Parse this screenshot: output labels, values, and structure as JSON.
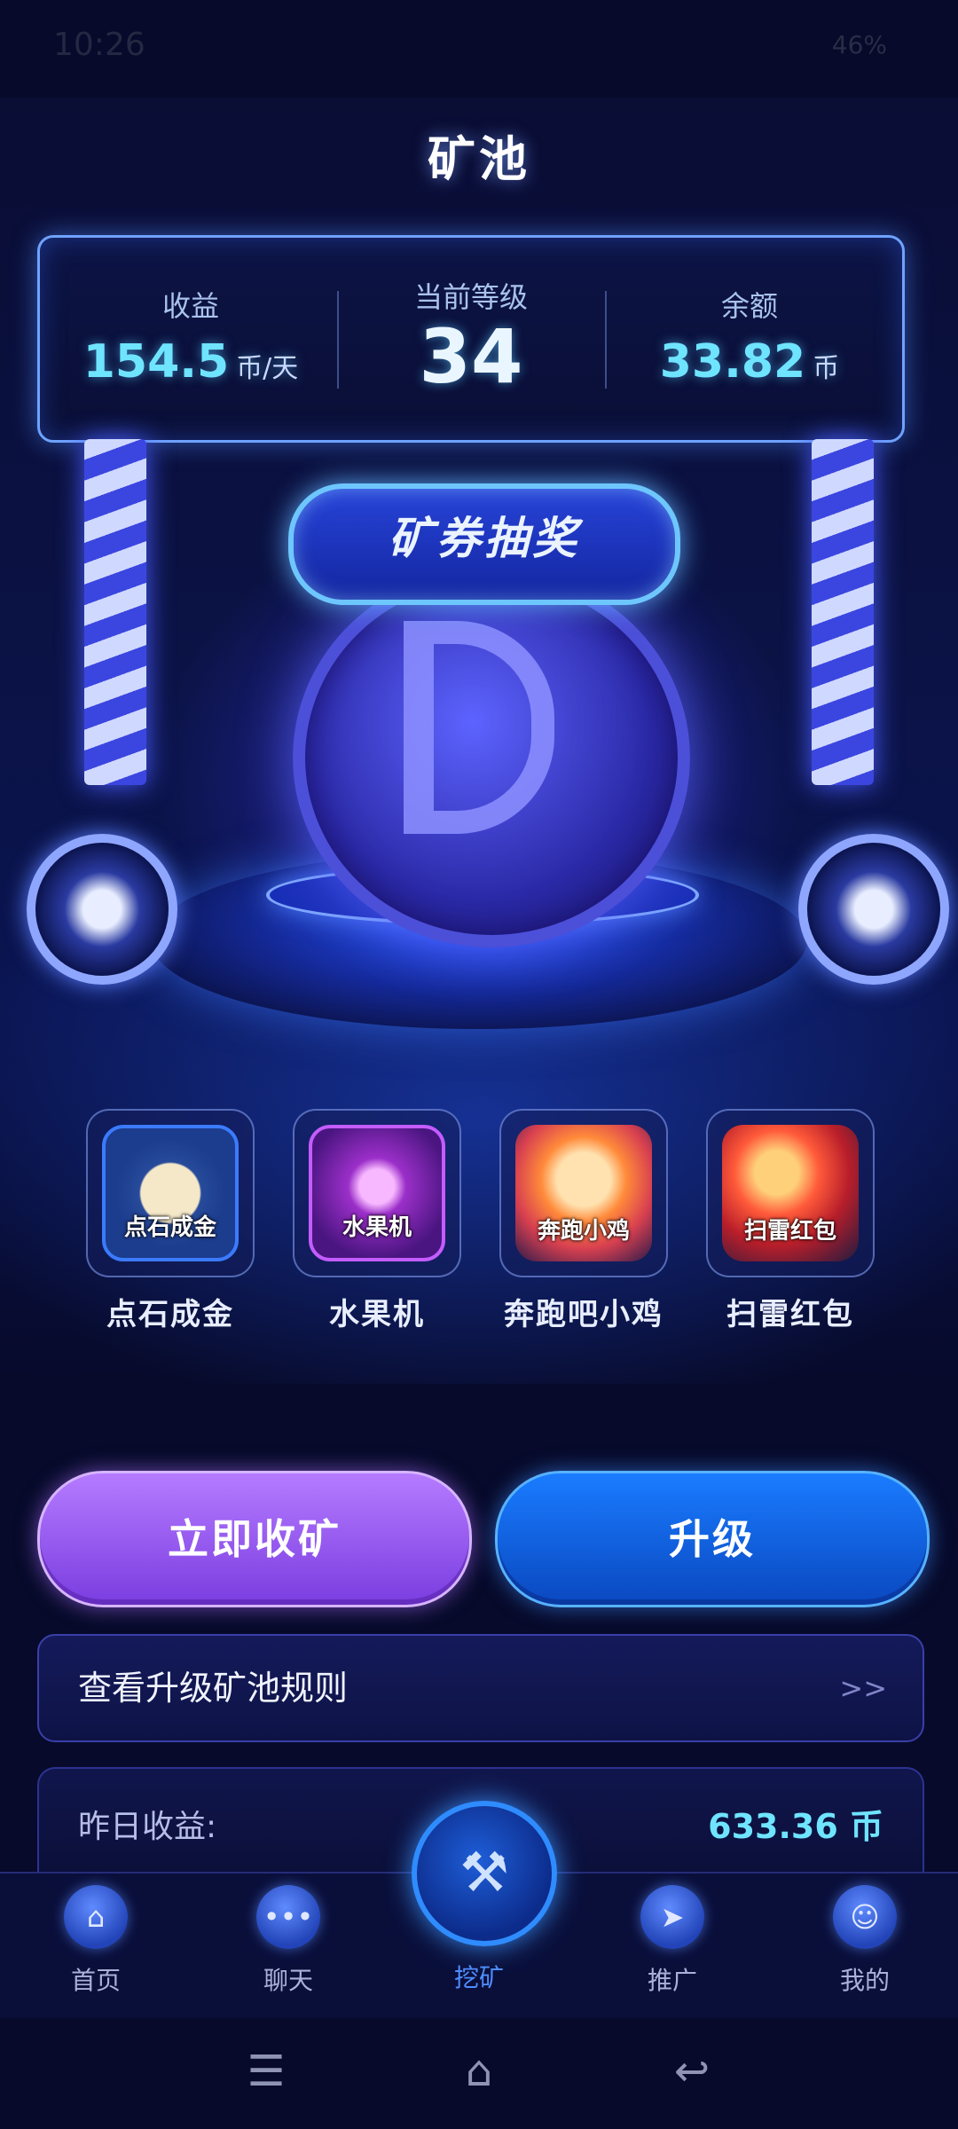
{
  "status_bar": {
    "time": "10:26",
    "right": "46%"
  },
  "page_title": "矿池",
  "stats": {
    "income_label": "收益",
    "income_value": "154.5",
    "income_unit": "币/天",
    "level_label": "当前等级",
    "level_value": "34",
    "balance_label": "余额",
    "balance_value": "33.82",
    "balance_unit": "币"
  },
  "lottery_banner": "矿券抽奖",
  "games": [
    {
      "label": "点石成金",
      "icon_text": "点石成金",
      "icon": "gold-stone-icon"
    },
    {
      "label": "水果机",
      "icon_text": "水果机",
      "icon": "fruit-machine-icon"
    },
    {
      "label": "奔跑吧小鸡",
      "icon_text": "奔跑小鸡",
      "icon": "running-chick-icon"
    },
    {
      "label": "扫雷红包",
      "icon_text": "扫雷红包",
      "icon": "red-packet-icon"
    }
  ],
  "actions": {
    "collect": "立即收矿",
    "upgrade": "升级"
  },
  "rules": {
    "text": "查看升级矿池规则",
    "arrow": ">>"
  },
  "yesterday": {
    "label": "昨日收益:",
    "value": "633.36 币"
  },
  "nav": [
    {
      "label": "首页",
      "icon": "home-icon"
    },
    {
      "label": "聊天",
      "icon": "chat-icon"
    },
    {
      "label": "挖矿",
      "icon": "hammer-icon",
      "active": true
    },
    {
      "label": "推广",
      "icon": "paper-plane-icon"
    },
    {
      "label": "我的",
      "icon": "profile-icon"
    }
  ],
  "colors": {
    "accent": "#6fe4ff",
    "collect_button": "#9a5cf0",
    "upgrade_button": "#1464e8",
    "active_nav": "#4f8dff"
  }
}
